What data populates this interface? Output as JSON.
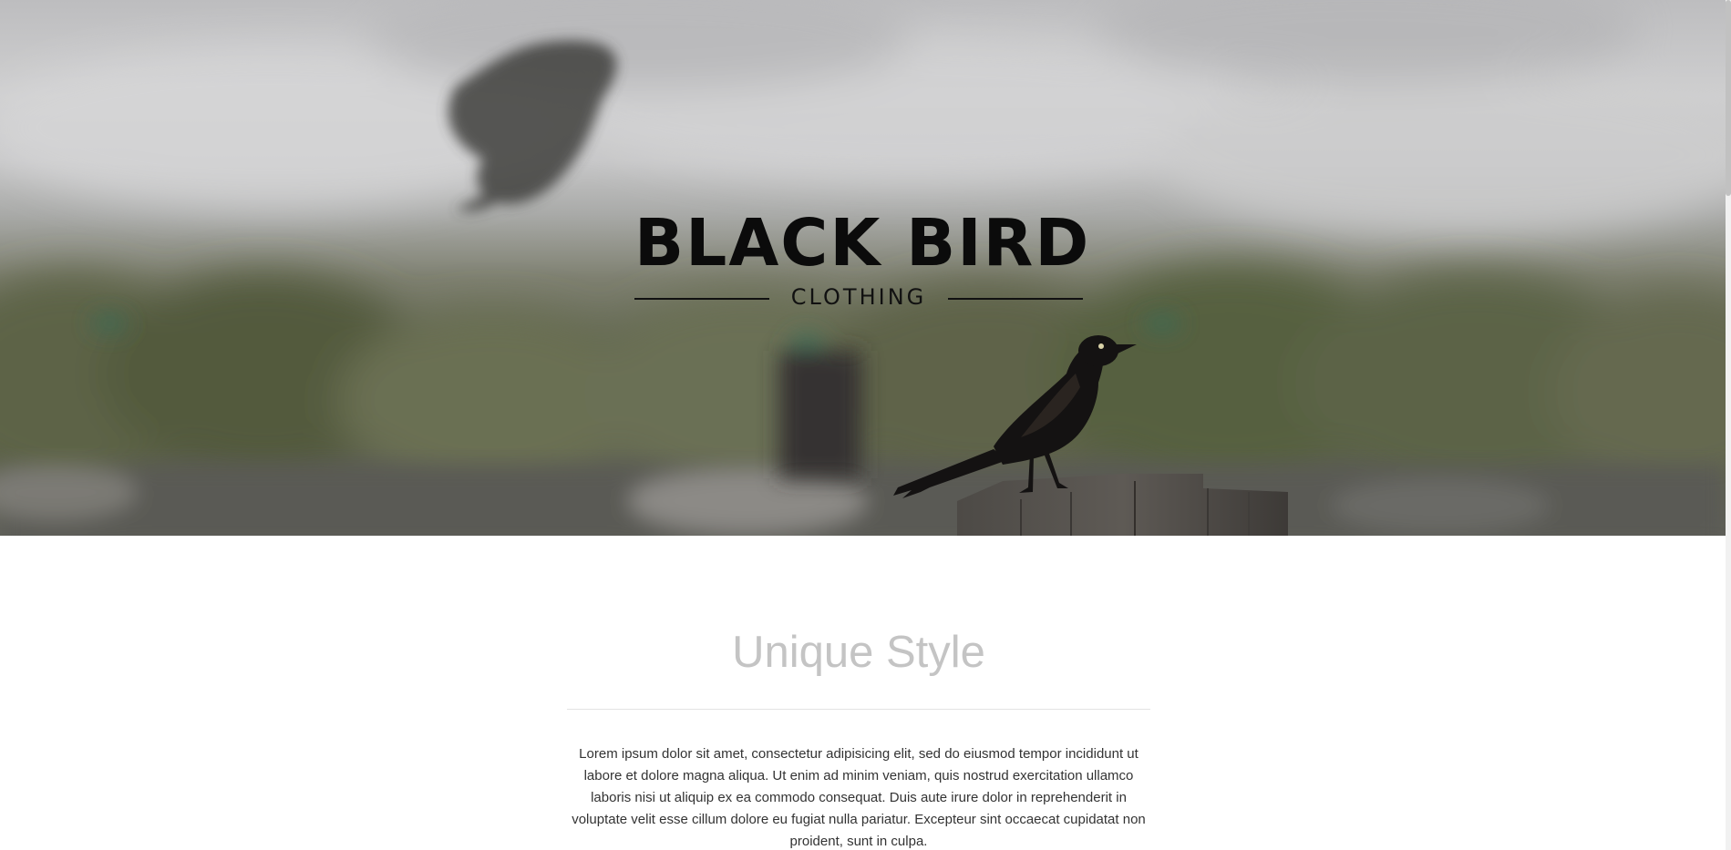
{
  "hero": {
    "brand_title": "BLACK BIRD",
    "brand_subtitle": "CLOTHING",
    "background_description_icon": "photo-bird-on-post-icon"
  },
  "section": {
    "title": "Unique Style",
    "body": "Lorem ipsum dolor sit amet, consectetur adipisicing elit, sed do eiusmod tempor incididunt ut labore et dolore magna aliqua. Ut enim ad minim veniam, quis nostrud exercitation ullamco laboris nisi ut aliquip ex ea commodo consequat. Duis aute irure dolor in reprehenderit in voluptate velit esse cillum dolore eu fugiat nulla pariatur. Excepteur sint occaecat cupidatat non proident, sunt in culpa."
  },
  "colors": {
    "title_text": "#0b0b0b",
    "section_title": "#c4c4c4",
    "body_text": "#333333",
    "divider": "#e3e3e3"
  }
}
